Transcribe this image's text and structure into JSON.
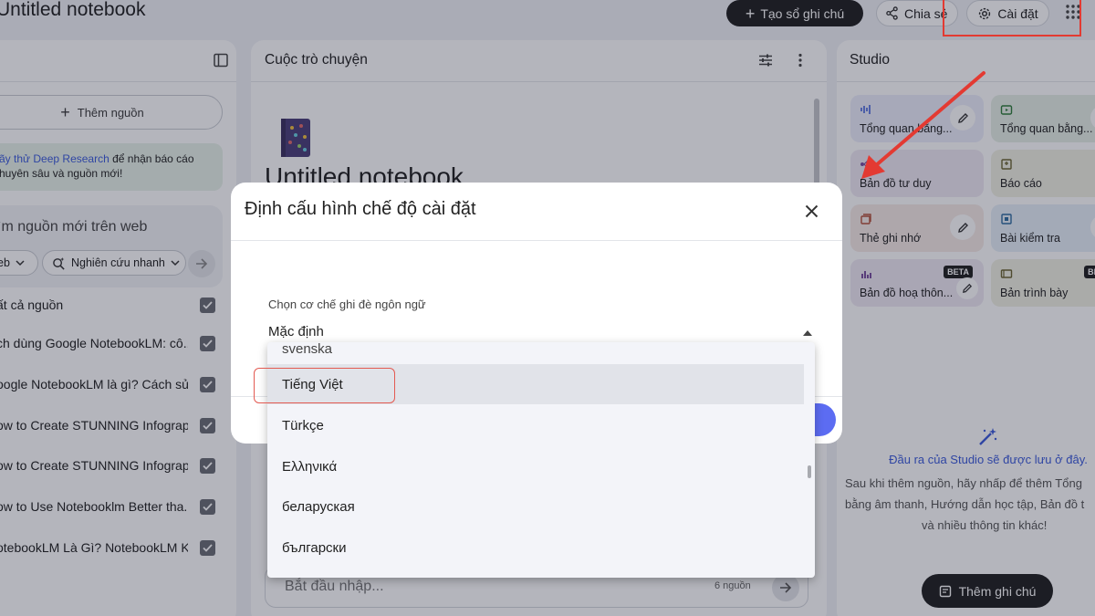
{
  "header": {
    "notebook_title": "Untitled notebook",
    "create_label": "Tạo sổ ghi chú",
    "share_label": "Chia sẻ",
    "settings_label": "Cài đặt"
  },
  "sources_panel": {
    "add_source_label": "Thêm nguồn",
    "promo_link": "ãy thử Deep Research",
    "promo_rest": " để nhận báo cáo",
    "promo_line2": "huyên sâu và nguồn mới!",
    "search_title": "ìm nguồn mới trên web",
    "chip_web": "eb",
    "chip_research": "Nghiên cứu nhanh",
    "select_all": "ất cả nguồn",
    "items": [
      "ch dùng Google NotebookLM: cô...",
      "oogle NotebookLM là gì? Cách sử ...",
      "ow to Create STUNNING Infograp...",
      "ow to Create STUNNING Infograp...",
      "ow to Use Notebooklm Better tha...",
      "otebookLM Là Gì? NotebookLM K..."
    ]
  },
  "chat_panel": {
    "title": "Cuộc trò chuyện",
    "notebook_heading": "Untitled notebook",
    "input_placeholder": "Bắt đầu nhập...",
    "source_count": "6 nguồn"
  },
  "studio_panel": {
    "title": "Studio",
    "tiles": [
      {
        "label": "Tổng quan bằng...",
        "color": "#eceefb",
        "beta": ""
      },
      {
        "label": "Tổng quan bằng...",
        "color": "#e6efe6",
        "beta": ""
      },
      {
        "label": "Bản đồ tư duy",
        "color": "#efe9f4",
        "beta": ""
      },
      {
        "label": "Báo cáo",
        "color": "#f1f0e4",
        "beta": ""
      },
      {
        "label": "Thẻ ghi nhớ",
        "color": "#f6ebe6",
        "beta": ""
      },
      {
        "label": "Bài kiểm tra",
        "color": "#e6eff8",
        "beta": ""
      },
      {
        "label": "Bản đồ hoạ thôn...",
        "color": "#efe9f4",
        "beta": "BETA"
      },
      {
        "label": "Bản trình bày",
        "color": "#f1f0e4",
        "beta": "BETA"
      }
    ],
    "empty_title": "Đầu ra của Studio sẽ được lưu ở đây.",
    "empty_line1": "Sau khi thêm nguồn, hãy nhấp để thêm Tổng",
    "empty_line2": "bằng âm thanh, Hướng dẫn học tập, Bản đồ t",
    "empty_line3": "và nhiều thông tin khác!",
    "add_note_label": "Thêm ghi chú"
  },
  "modal": {
    "title": "Định cấu hình chế độ cài đặt",
    "field_label": "Chọn cơ chế ghi đè ngôn ngữ",
    "field_value": "Mặc định"
  },
  "dropdown": {
    "partial_option": "svenska",
    "options": [
      "Tiếng Việt",
      "Türkçe",
      "Ελληνικά",
      "беларуская",
      "български"
    ],
    "selected_index": 0
  },
  "colors": {
    "annotation_red": "#e33a32",
    "accent_blue": "#3b5bdb",
    "primary_button": "#1f1f1f"
  }
}
